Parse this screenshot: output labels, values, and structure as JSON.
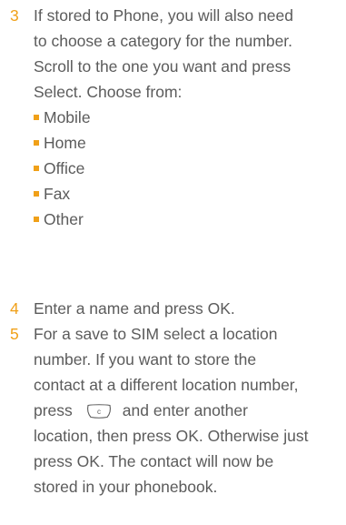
{
  "steps": [
    {
      "number": "3",
      "lines": [
        "If stored to Phone, you will also need",
        "to choose a category for the number.",
        "Scroll to the one you want and press",
        "Select. Choose from:"
      ],
      "options": [
        "Mobile",
        "Home",
        "Office",
        "Fax",
        "Other"
      ]
    },
    {
      "number": "4",
      "lines": [
        "Enter a name and press OK."
      ]
    },
    {
      "number": "5",
      "lines": [
        "For a save to SIM select a location",
        "number. If you want to store the",
        "contact at a different location number,"
      ],
      "press_before": "press",
      "press_after": "and enter another",
      "lines_after": [
        "location, then press OK. Otherwise just",
        "press OK. The contact will now be",
        "stored in your phonebook."
      ]
    }
  ],
  "icons": {
    "clear_key": "clear-key-icon"
  },
  "colors": {
    "accent": "#f0a018",
    "text": "#5b5b5b"
  }
}
